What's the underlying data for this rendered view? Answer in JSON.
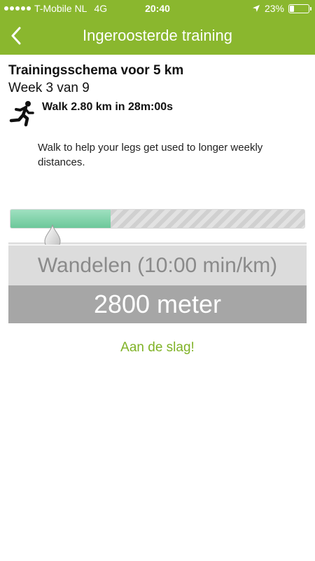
{
  "status_bar": {
    "carrier": "T-Mobile NL",
    "network": "4G",
    "time": "20:40",
    "battery": "23%",
    "battery_level": 0.23,
    "signal_icon": "signal-dots-icon",
    "location_icon": "location-arrow-icon"
  },
  "nav": {
    "title": "Ingeroosterde training",
    "back_icon": "chevron-left-icon"
  },
  "plan": {
    "title": "Trainingsschema voor 5 km",
    "week": "Week 3 van 9",
    "activity_icon": "running-person-icon",
    "workout": "Walk 2.80 km in 28m:00s",
    "description": "Walk to help your legs get used to longer weekly distances."
  },
  "workout_progress": {
    "completed_fraction": 0.34,
    "slider_position_fraction": 0.147
  },
  "segment": {
    "label": "Wandelen (10:00 min/km)",
    "distance": "2800 meter"
  },
  "actions": {
    "start_label": "Aan de slag!"
  },
  "colors": {
    "header": "#8ab72e",
    "accent": "#7fb226",
    "progress_done": "#6cc89a",
    "segment_bg": "#dcdcdc",
    "distance_bg": "#a6a6a6"
  }
}
